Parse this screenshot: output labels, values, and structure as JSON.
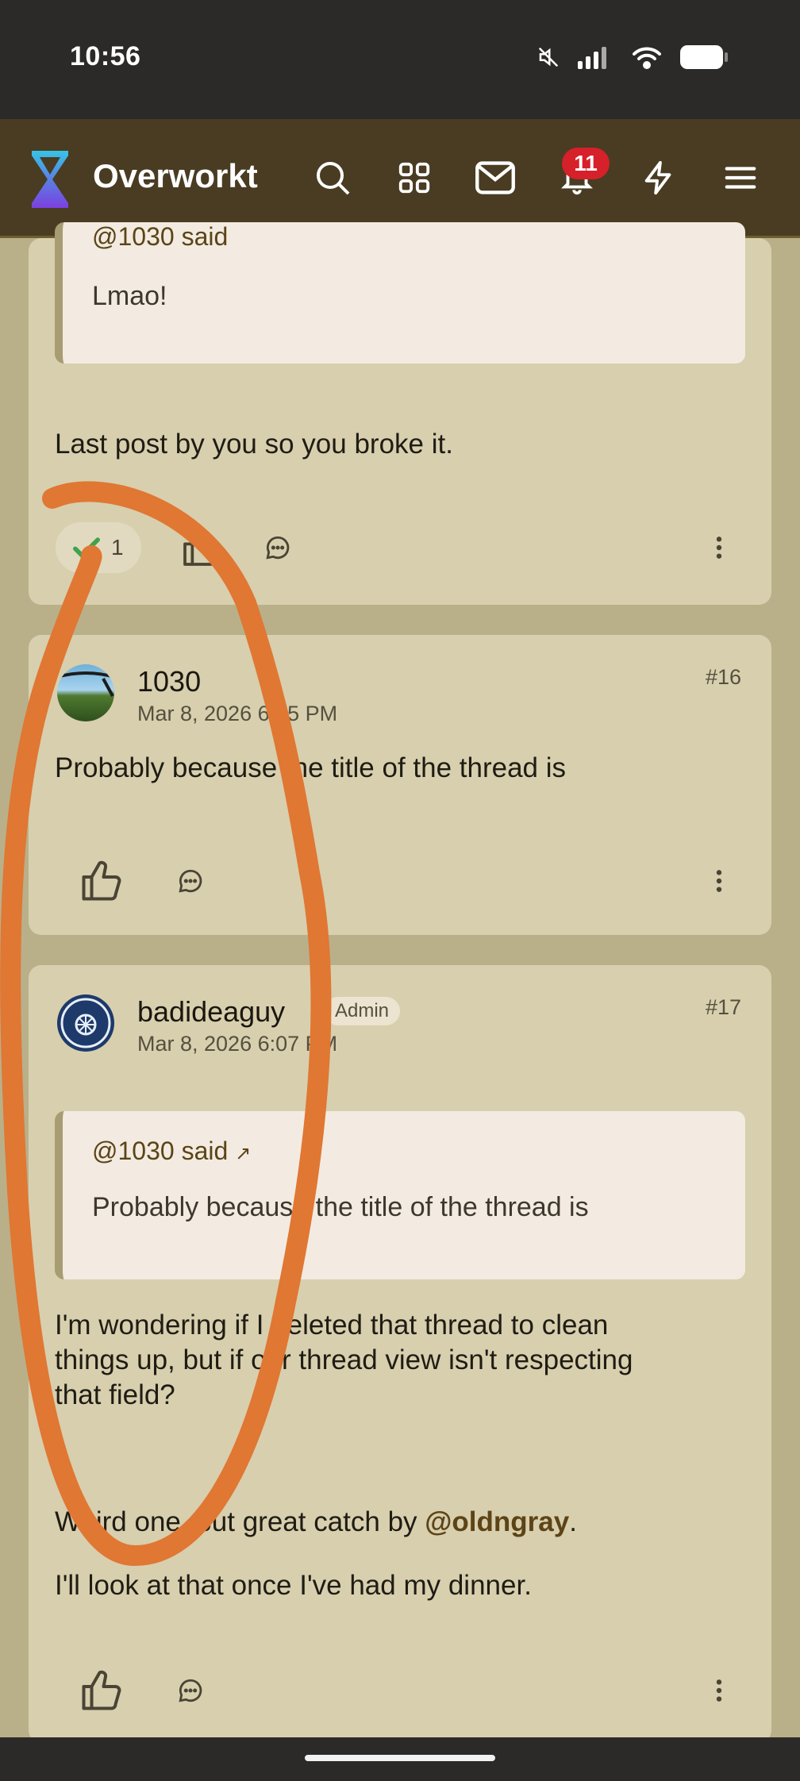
{
  "status_bar": {
    "time": "10:56"
  },
  "app_bar": {
    "site_name": "Overworkt",
    "notification_count": "11"
  },
  "posts": [
    {
      "quote_attr": "@1030 said",
      "quote_text": "Lmao!",
      "body": "Last post by you so you broke it.",
      "reaction_count": "1"
    },
    {
      "author": "1030",
      "date": "Mar 8, 2026 6:05 PM",
      "number": "#16",
      "body": "Probably because the title of the thread is"
    },
    {
      "author": "badideaguy",
      "role": "Admin",
      "date": "Mar 8, 2026 6:07 PM",
      "number": "#17",
      "quote_attr": "@1030 said",
      "quote_text": "Probably because the title of the thread is",
      "body": "I'm wondering if I deleted that thread to clean\nthings up, but if our thread view isn't respecting\nthat field?",
      "body2_pre": "Weird one, but great catch by ",
      "mention": "@oldngray",
      "body2_post": ".",
      "body3": "I'll look at that once I've had my dinner."
    }
  ],
  "colors": {
    "accent_orange": "#e07733",
    "appbar_bg": "#493c22",
    "card_bg": "#d8cfae"
  },
  "icons": [
    "search-icon",
    "apps-grid-icon",
    "mail-icon",
    "bell-icon",
    "bolt-icon",
    "menu-icon",
    "thumbs-up-icon",
    "reply-icon",
    "more-vertical-icon"
  ]
}
